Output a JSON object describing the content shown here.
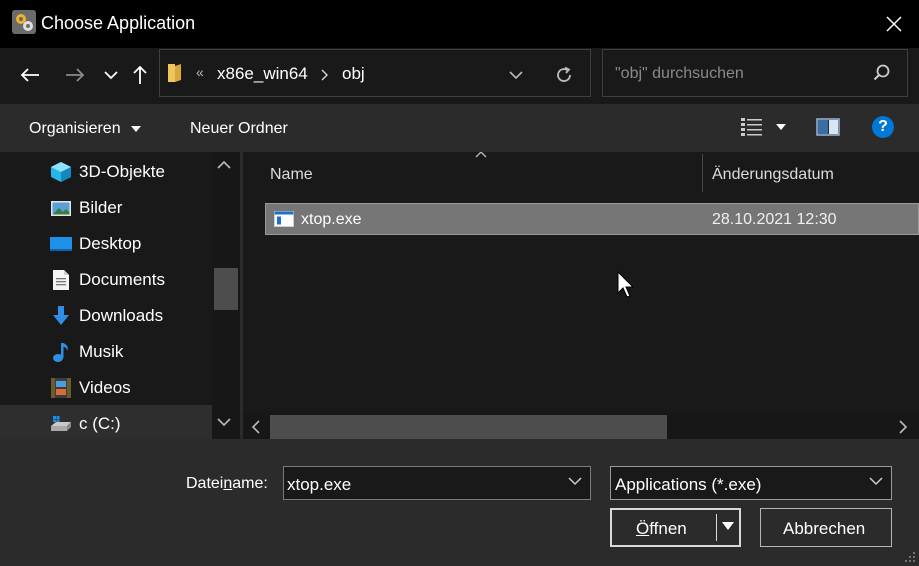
{
  "window": {
    "title": "Choose Application",
    "close_icon": "close-icon"
  },
  "navigation": {
    "back_icon": "back-arrow-icon",
    "forward_icon": "forward-arrow-icon",
    "recent_icon": "chevron-down-icon",
    "up_icon": "up-arrow-icon"
  },
  "address_bar": {
    "overflow_marker": "«",
    "crumbs": [
      "x86e_win64",
      "obj"
    ]
  },
  "search": {
    "placeholder": "\"obj\" durchsuchen"
  },
  "toolbar": {
    "organize_label": "Organisieren",
    "new_folder_label": "Neuer Ordner",
    "help_label": "?"
  },
  "nav_pane": {
    "items": [
      {
        "label": "3D-Objekte",
        "icon": "3d-objects-icon"
      },
      {
        "label": "Bilder",
        "icon": "pictures-icon"
      },
      {
        "label": "Desktop",
        "icon": "desktop-icon"
      },
      {
        "label": "Documents",
        "icon": "documents-icon"
      },
      {
        "label": "Downloads",
        "icon": "downloads-icon"
      },
      {
        "label": "Musik",
        "icon": "music-icon"
      },
      {
        "label": "Videos",
        "icon": "videos-icon"
      },
      {
        "label": "c (C:)",
        "icon": "drive-icon",
        "selected": true
      }
    ]
  },
  "file_list": {
    "columns": [
      "Name",
      "Änderungsdatum"
    ],
    "rows": [
      {
        "name": "xtop.exe",
        "date": "28.10.2021 12:30",
        "icon": "exe-file-icon",
        "selected": true
      }
    ]
  },
  "bottom": {
    "filename_label_pre": "Datei",
    "filename_label_ul": "n",
    "filename_label_post": "ame:",
    "filename_value": "xtop.exe",
    "filetype_value": "Applications (*.exe)",
    "open_label_ul": "Ö",
    "open_label_post": "ffnen",
    "cancel_label": "Abbrechen"
  },
  "colors": {
    "titlebar": "#000000",
    "pane_bg": "#191919",
    "chrome_bg": "#2b2b2b",
    "selection": "#767676",
    "help_blue": "#0078d7"
  }
}
